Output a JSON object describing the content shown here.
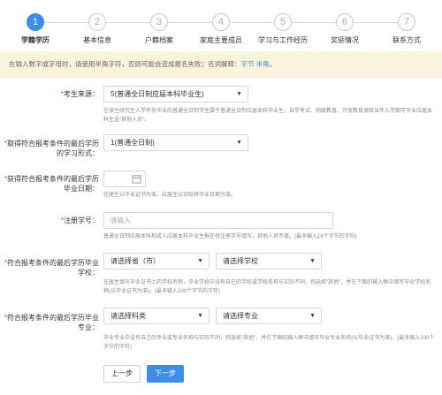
{
  "steps": [
    {
      "num": "1",
      "label": "学籍学历"
    },
    {
      "num": "2",
      "label": "基本信息"
    },
    {
      "num": "3",
      "label": "户籍档案"
    },
    {
      "num": "4",
      "label": "家庭主要成员"
    },
    {
      "num": "5",
      "label": "学习与工作经历"
    },
    {
      "num": "6",
      "label": "奖惩情况"
    },
    {
      "num": "7",
      "label": "联系方式"
    }
  ],
  "notice": {
    "text": "在输入数字或字母时，请使用半角字符，否则可能会造成报名失败；名词解释：",
    "link1": "字节",
    "link2": "半角",
    "end": "。"
  },
  "form": {
    "source": {
      "label": "考生来源：",
      "value": "5(普通全日制应届本科毕业生)",
      "hint": "在读主研究生入学年份毕业的普通全日制学生属于普通全日制应届本科毕业生，自学考试、网络教育、开放教育录取当年入学期可毕业应届本科生选\"其他人员\"。"
    },
    "study_form": {
      "label": "取得符合报考条件的最后学历的学习形式：",
      "value": "1(普通全日制)"
    },
    "grad_date": {
      "label": "获得符合报考条件的最后学历毕业日期：",
      "value": "",
      "hint": "往届生以毕业证书为准，应届生以实际将毕业日期为准。"
    },
    "student_id": {
      "label": "注册学号：",
      "placeholder": "请输入",
      "hint": "普通全日制应届本科和成人应届本科毕业生报在校注册学号填写，其他人员不填。(最多输入16个字节的字符)"
    },
    "school": {
      "label": "符合报考条件的最后学历毕业学校：",
      "province": "请选择省（市）",
      "school_select": "请选择学校",
      "hint": "往届生填写毕业证书上的学校名称，毕业学校中没有自己的学校或学校名称与实际不同，则选择\"其他\"，并在下面的输入框中填写毕业学校名称(以毕业证书为准)。(最多输入100个字节的字符)"
    },
    "major": {
      "label": "符合报考条件的最后学历毕业专业：",
      "category": "请选择科类",
      "major_select": "请选择专业",
      "hint": "毕业专业中没有自己的专业或专业名称与实际不同，则选择\"其他\"，并在下面的输入框中填写毕业专业名称(以毕业证书为准)。(最多输入100个字节的字符)"
    }
  },
  "buttons": {
    "prev": "上一步",
    "next": "下一步"
  },
  "colors": {
    "accent": "#3d8ee6",
    "required": "#e33333",
    "notice_bg": "#fbf4dd"
  }
}
